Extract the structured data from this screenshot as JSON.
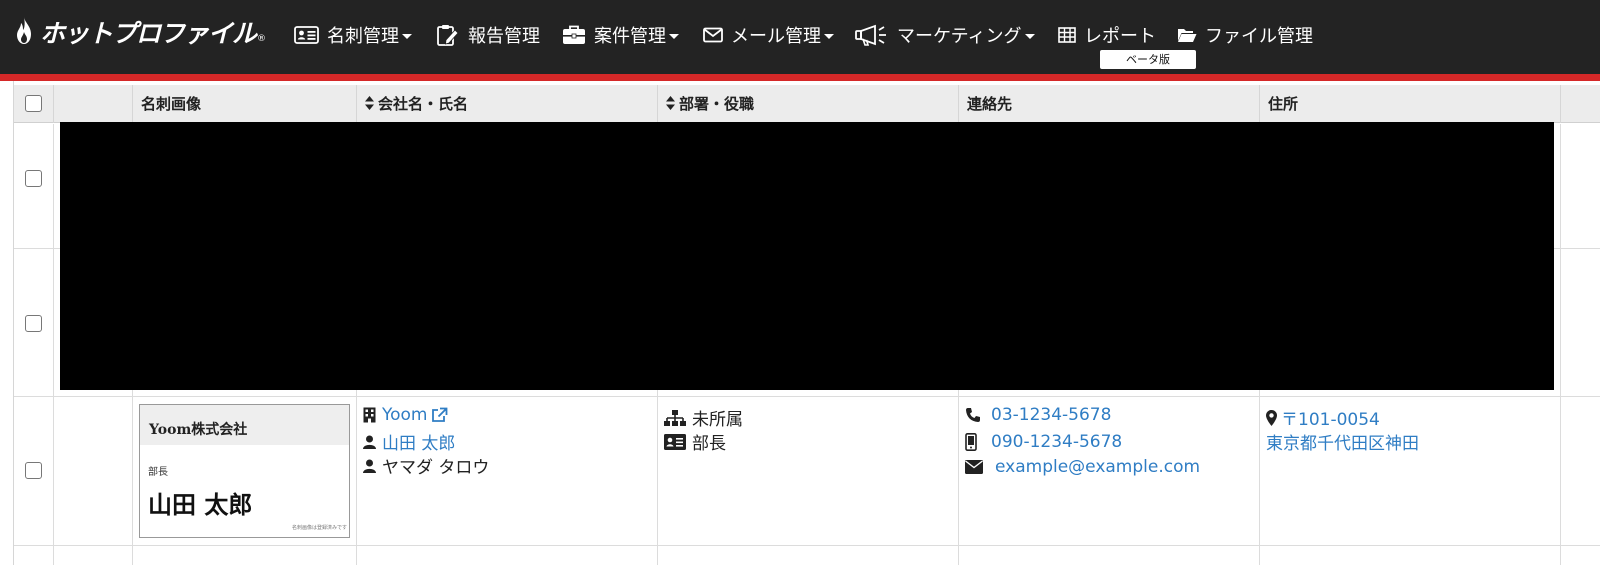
{
  "app": {
    "logo_text": "ホットプロファイル",
    "logo_reg": "®"
  },
  "nav": {
    "items": [
      {
        "label": "名刺管理",
        "icon": "id-card-icon",
        "has_dropdown": true
      },
      {
        "label": "報告管理",
        "icon": "report-edit-icon",
        "has_dropdown": false
      },
      {
        "label": "案件管理",
        "icon": "briefcase-icon",
        "has_dropdown": true
      },
      {
        "label": "メール管理",
        "icon": "envelope-icon",
        "has_dropdown": true
      },
      {
        "label": "マーケティング",
        "icon": "megaphone-icon",
        "has_dropdown": true
      },
      {
        "label": "レポート",
        "icon": "table-icon",
        "has_dropdown": false
      },
      {
        "label": "ファイル管理",
        "icon": "folder-open-icon",
        "has_dropdown": false
      }
    ],
    "beta_label": "ベータ版"
  },
  "colors": {
    "navbar_bg": "#232323",
    "accent_red": "#d52828",
    "link_blue": "#2f7dc4",
    "header_bg": "#ececec"
  },
  "table": {
    "columns": [
      {
        "key": "select",
        "label": ""
      },
      {
        "key": "blank",
        "label": ""
      },
      {
        "key": "card_image",
        "label": "名刺画像",
        "sortable": false
      },
      {
        "key": "company_name",
        "label": "会社名・氏名",
        "sortable": true
      },
      {
        "key": "department_title",
        "label": "部署・役職",
        "sortable": true
      },
      {
        "key": "contact",
        "label": "連絡先",
        "sortable": false
      },
      {
        "key": "address",
        "label": "住所",
        "sortable": false
      }
    ],
    "rows": [
      {
        "card": {
          "company": "Yoom株式会社",
          "title": "部長",
          "name": "山田 太郎",
          "fine_print": "名刺画像は登録済みです"
        },
        "company": "Yoom",
        "person_name": "山田 太郎",
        "person_kana": "ヤマダ タロウ",
        "department": "未所属",
        "position": "部長",
        "phone": "03-1234-5678",
        "mobile": "090-1234-5678",
        "email": "example@example.com",
        "postal": "〒101-0054",
        "address": "東京都千代田区神田"
      }
    ]
  }
}
